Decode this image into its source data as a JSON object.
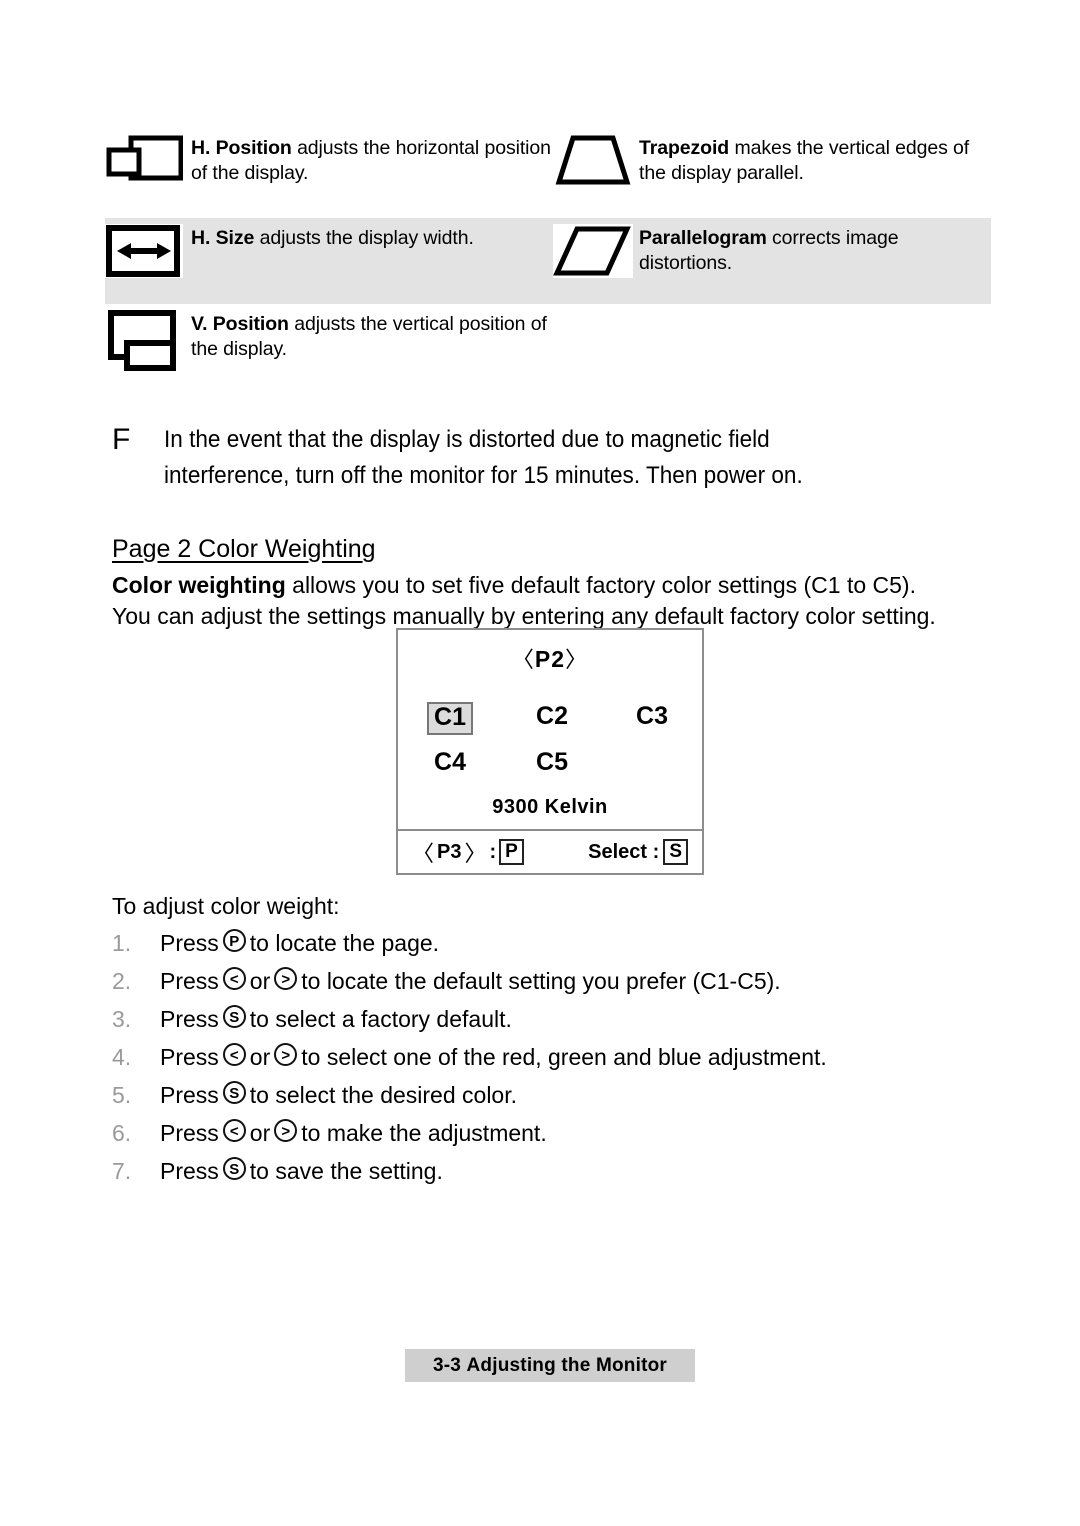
{
  "features": [
    {
      "icon": "h-position-icon",
      "title": "H. Position",
      "desc": "adjusts the horizontal position of the display.",
      "shaded": false
    },
    {
      "icon": "trapezoid-icon",
      "title": "Trapezoid",
      "desc": "makes the vertical edges of the display parallel.",
      "shaded": false
    },
    {
      "icon": "h-size-icon",
      "title": "H. Size",
      "desc": "adjusts the display width.",
      "shaded": true
    },
    {
      "icon": "parallelogram-icon",
      "title": "Parallelogram",
      "desc": "corrects image distortions.",
      "shaded": true
    },
    {
      "icon": "v-position-icon",
      "title": "V. Position",
      "desc": "adjusts the vertical position of the display.",
      "shaded": false
    }
  ],
  "note": {
    "symbol": "F",
    "line1": "In the event that the display is distorted due to magnetic field",
    "line2": "interference, turn off the monitor for 15 minutes.  Then power on."
  },
  "section": {
    "heading": "Page 2 Color Weighting",
    "lead": "Color weighting",
    "para_line1": " allows you to set five default factory color settings (C1 to C5).",
    "para_line2": "You can adjust the settings manually by entering any default factory color setting."
  },
  "osd": {
    "title": "P2",
    "chev_left": "〈",
    "chev_right": "〉",
    "presets_row1": [
      "C1",
      "C2",
      "C3"
    ],
    "presets_row2": [
      "C4",
      "C5"
    ],
    "selected_preset": "C1",
    "kelvin": "9300  Kelvin",
    "footer_left_label": "P3",
    "footer_left_sep": ":",
    "footer_left_key": "P",
    "footer_right_label": "Select :",
    "footer_right_key": "S",
    "highlight_color": "#dcdcdc",
    "border_color": "#8d8d8d"
  },
  "steps_intro": "To adjust color weight:",
  "steps": [
    {
      "num": "1.",
      "pre": "Press",
      "keys": [
        "P"
      ],
      "joiners": [],
      "post": "to locate the page."
    },
    {
      "num": "2.",
      "pre": "Press",
      "keys": [
        "<",
        ">"
      ],
      "joiners": [
        "or"
      ],
      "post": "to locate the default setting you prefer (C1-C5)."
    },
    {
      "num": "3.",
      "pre": "Press",
      "keys": [
        "S"
      ],
      "joiners": [],
      "post": "to select a factory default."
    },
    {
      "num": "4.",
      "pre": "Press",
      "keys": [
        "<",
        ">"
      ],
      "joiners": [
        "or"
      ],
      "post": "to select one of the red, green and blue adjustment."
    },
    {
      "num": "5.",
      "pre": "Press",
      "keys": [
        "S"
      ],
      "joiners": [],
      "post": "to select the desired color."
    },
    {
      "num": "6.",
      "pre": "Press",
      "keys": [
        "<",
        ">"
      ],
      "joiners": [
        "or"
      ],
      "post": "to make the adjustment."
    },
    {
      "num": "7.",
      "pre": "Press",
      "keys": [
        "S"
      ],
      "joiners": [],
      "post": "to save the setting."
    }
  ],
  "footer": {
    "page_number": "3-3",
    "title": "Adjusting the Monitor"
  }
}
